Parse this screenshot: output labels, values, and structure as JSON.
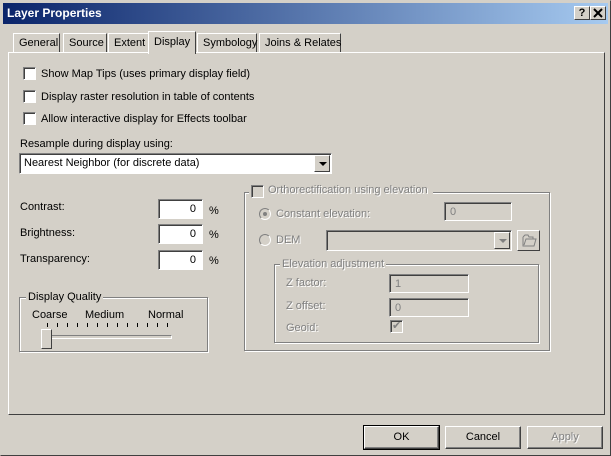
{
  "window": {
    "title": "Layer Properties",
    "help_label": "?",
    "close_label": "X"
  },
  "tabs": [
    {
      "label": "General"
    },
    {
      "label": "Source"
    },
    {
      "label": "Extent"
    },
    {
      "label": "Display",
      "active": true
    },
    {
      "label": "Symbology"
    },
    {
      "label": "Joins & Relates"
    }
  ],
  "options": {
    "map_tips": "Show Map Tips (uses primary display field)",
    "raster_resolution": "Display raster resolution in table of contents",
    "interactive_effects": "Allow interactive display for Effects toolbar"
  },
  "resample": {
    "label": "Resample during display using:",
    "value": "Nearest Neighbor (for discrete data)"
  },
  "adjust": {
    "contrast": {
      "label": "Contrast:",
      "value": "0",
      "unit": "%"
    },
    "brightness": {
      "label": "Brightness:",
      "value": "0",
      "unit": "%"
    },
    "transparency": {
      "label": "Transparency:",
      "value": "0",
      "unit": "%"
    }
  },
  "display_quality": {
    "legend": "Display Quality",
    "coarse": "Coarse",
    "medium": "Medium",
    "normal": "Normal",
    "level": 0
  },
  "ortho": {
    "legend": "Orthorectification using elevation",
    "constant_label": "Constant elevation:",
    "constant_value": "0",
    "dem_label": "DEM",
    "dem_value": "",
    "elev_legend": "Elevation adjustment",
    "zfactor_label": "Z factor:",
    "zfactor_value": "1",
    "zoffset_label": "Z offset:",
    "zoffset_value": "0",
    "geoid_label": "Geoid:"
  },
  "buttons": {
    "ok": "OK",
    "cancel": "Cancel",
    "apply": "Apply"
  }
}
